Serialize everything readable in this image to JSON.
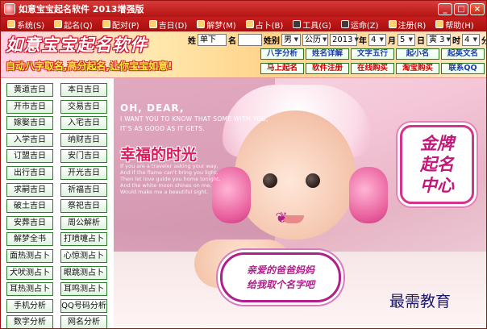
{
  "window": {
    "title": "如意宝宝起名软件 2013增强版",
    "min_label": "_",
    "max_label": "□",
    "close_label": "×"
  },
  "menu": [
    {
      "label": "系统(S)"
    },
    {
      "label": "起名(Q)"
    },
    {
      "label": "配对(P)"
    },
    {
      "label": "吉日(D)"
    },
    {
      "label": "解梦(M)"
    },
    {
      "label": "占卜(B)"
    },
    {
      "label": "工具(G)"
    },
    {
      "label": "运命(Z)"
    },
    {
      "label": "注册(R)"
    },
    {
      "label": "帮助(H)"
    }
  ],
  "banner": {
    "logo_text": "如意宝宝起名软件",
    "slogan": "自动八字取名,高分起名,让你宝宝如意!"
  },
  "form": {
    "surname_label": "姓",
    "surname_value": "单下",
    "name_label": "名",
    "name_value": "",
    "gender_label": "姓别",
    "gender_value": "男",
    "calendar_value": "公历",
    "year_value": "2013",
    "year_label": "年",
    "month_value": "4",
    "month_label": "月",
    "day_value": "5",
    "day_label": "日",
    "hour_value": "寅 3",
    "hour_label": "时",
    "minute_value": "4",
    "minute_label": "分"
  },
  "header_buttons": [
    {
      "label": "八字分析",
      "color": "blue"
    },
    {
      "label": "姓名详解",
      "color": "blue"
    },
    {
      "label": "文字五行",
      "color": "blue"
    },
    {
      "label": "起小名",
      "color": "blue"
    },
    {
      "label": "起英文名",
      "color": "blue"
    },
    {
      "label": "马上起名",
      "color": "red"
    },
    {
      "label": "软件注册",
      "color": "red"
    },
    {
      "label": "在线购买",
      "color": "red"
    },
    {
      "label": "淘宝购买",
      "color": "red"
    },
    {
      "label": "联系QQ",
      "color": "blue"
    }
  ],
  "side_buttons": [
    {
      "label": "黄道吉日"
    },
    {
      "label": "本日吉日"
    },
    {
      "label": "开市吉日"
    },
    {
      "label": "交易吉日"
    },
    {
      "label": "嫁娶吉日"
    },
    {
      "label": "入宅吉日"
    },
    {
      "label": "入学吉日"
    },
    {
      "label": "纳财吉日"
    },
    {
      "label": "订盟吉日"
    },
    {
      "label": "安门吉日"
    },
    {
      "label": "出行吉日"
    },
    {
      "label": "开光吉日"
    },
    {
      "label": "求嗣吉日"
    },
    {
      "label": "祈福吉日"
    },
    {
      "label": "破土吉日"
    },
    {
      "label": "祭祀吉日"
    },
    {
      "label": "安葬吉日"
    },
    {
      "label": "周公解析"
    },
    {
      "label": "解梦全书"
    },
    {
      "label": "打喷嚏占卜"
    },
    {
      "label": "面热测占卜"
    },
    {
      "label": "心惊测占卜"
    },
    {
      "label": "犬吠测占卜"
    },
    {
      "label": "眼跳测占卜"
    },
    {
      "label": "耳热测占卜"
    },
    {
      "label": "耳鸣测占卜"
    },
    {
      "label": "手机分析"
    },
    {
      "label": "QQ号码分析"
    },
    {
      "label": "数字分析"
    },
    {
      "label": "网名分析"
    }
  ],
  "photo": {
    "oh_dear": "OH, DEAR,",
    "eng_line1": "I WANT YOU TO KNOW THAT SOME WITH YOU,",
    "eng_line2": "IT'S AS GOOD AS IT GETS.",
    "happy_text": "幸福的时光",
    "small_eng1": "If you are a traveler asking your way,",
    "small_eng2": "And if the flame can't bring you light,",
    "small_eng3": "Then let love guide you home tonight.",
    "small_eng4": "And the white moon shines on me,",
    "small_eng5": "Would make me a beautiful sight.",
    "badge_line1": "金牌",
    "badge_line2": "起名",
    "badge_line3": "中心",
    "bubble_line1": "亲爱的爸爸妈妈",
    "bubble_line2": "给我取个名字吧"
  },
  "watermark": "最需教育",
  "colors": {
    "titlebar": "#c41f1f",
    "accent_pink": "#c2187a",
    "button_border": "#2f7d2f"
  }
}
